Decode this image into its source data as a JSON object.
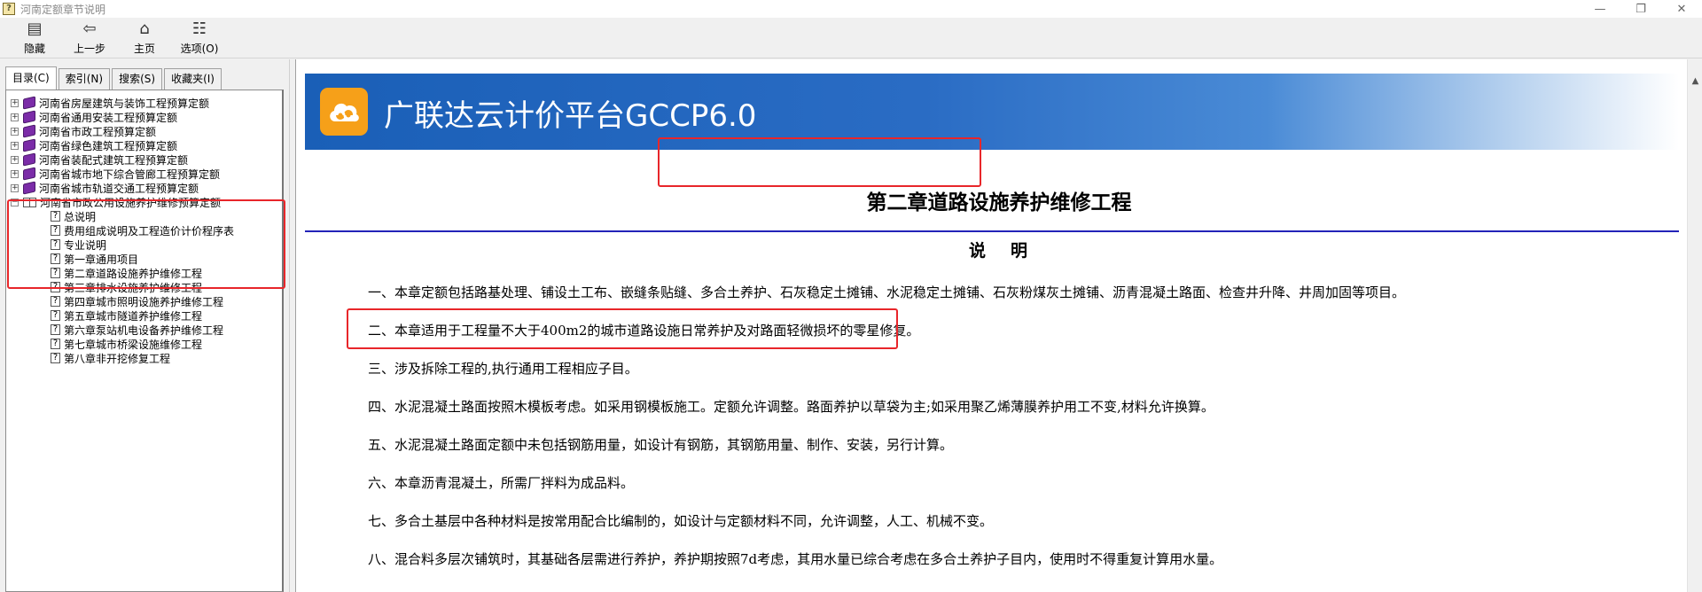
{
  "window": {
    "title": "河南定额章节说明",
    "app_icon": "?",
    "controls": {
      "minimize": "—",
      "maximize": "❐",
      "close": "✕"
    }
  },
  "toolbar": [
    {
      "name": "hide-button",
      "icon": "hide-icon",
      "glyph": "▤",
      "label": "隐藏"
    },
    {
      "name": "back-button",
      "icon": "back-arrow-icon",
      "glyph": "⇦",
      "label": "上一步"
    },
    {
      "name": "home-button",
      "icon": "home-icon",
      "glyph": "⌂",
      "label": "主页"
    },
    {
      "name": "options-button",
      "icon": "options-icon",
      "glyph": "☷",
      "label": "选项(O)"
    }
  ],
  "tabs": [
    {
      "label": "目录(C)",
      "active": true
    },
    {
      "label": "索引(N)",
      "active": false
    },
    {
      "label": "搜索(S)",
      "active": false
    },
    {
      "label": "收藏夹(I)",
      "active": false
    }
  ],
  "tree": {
    "books": [
      "河南省房屋建筑与装饰工程预算定额",
      "河南省通用安装工程预算定额",
      "河南省市政工程预算定额",
      "河南省绿色建筑工程预算定额",
      "河南省装配式建筑工程预算定额",
      "河南省城市地下综合管廊工程预算定额",
      "河南省城市轨道交通工程预算定额"
    ],
    "open_book": "河南省市政公用设施养护维修预算定额",
    "topics": [
      "总说明",
      "费用组成说明及工程造价计价程序表",
      "专业说明",
      "第一章通用项目",
      "第二章道路设施养护维修工程",
      "第三章排水设施养护维修工程",
      "第四章城市照明设施养护维修工程",
      "第五章城市隧道养护维修工程",
      "第六章泵站机电设备养护维修工程",
      "第七章城市桥梁设施维修工程",
      "第八章非开挖修复工程"
    ],
    "expander_closed": "+",
    "expander_open": "−",
    "help_glyph": "?"
  },
  "content": {
    "banner_title": "广联达云计价平台GCCP6.0",
    "chapter_title": "第二章道路设施养护维修工程",
    "section_title_a": "说",
    "section_title_b": "明",
    "paragraphs": [
      "一、本章定额包括路基处理、铺设土工布、嵌缝条贴缝、多合土养护、石灰稳定土摊铺、水泥稳定土摊铺、石灰粉煤灰土摊铺、沥青混凝土路面、检查井升降、井周加固等项目。",
      "二、本章适用于工程量不大于400m2的城市道路设施日常养护及对路面轻微损坏的零星修复。",
      "三、涉及拆除工程的,执行通用工程相应子目。",
      "四、水泥混凝土路面按照木模板考虑。如采用钢模板施工。定额允许调整。路面养护以草袋为主;如采用聚乙烯薄膜养护用工不变,材料允许换算。",
      "五、水泥混凝土路面定额中未包括钢筋用量，如设计有钢筋，其钢筋用量、制作、安装，另行计算。",
      "六、本章沥青混凝土，所需厂拌料为成品料。",
      "七、多合土基层中各种材料是按常用配合比编制的，如设计与定额材料不同，允许调整，人工、机械不变。",
      "八、混合料多层次铺筑时，其基础各层需进行养护，养护期按照7d考虑，其用水量已综合考虑在多合土养护子目内，使用时不得重复计算用水量。"
    ]
  },
  "scrollbar": {
    "up_arrow": "▲"
  },
  "colors": {
    "annotation_red": "#e8262a",
    "banner_blue": "#1a5fb7",
    "logo_orange": "#f6a019",
    "rule_blue": "#2323b8"
  }
}
